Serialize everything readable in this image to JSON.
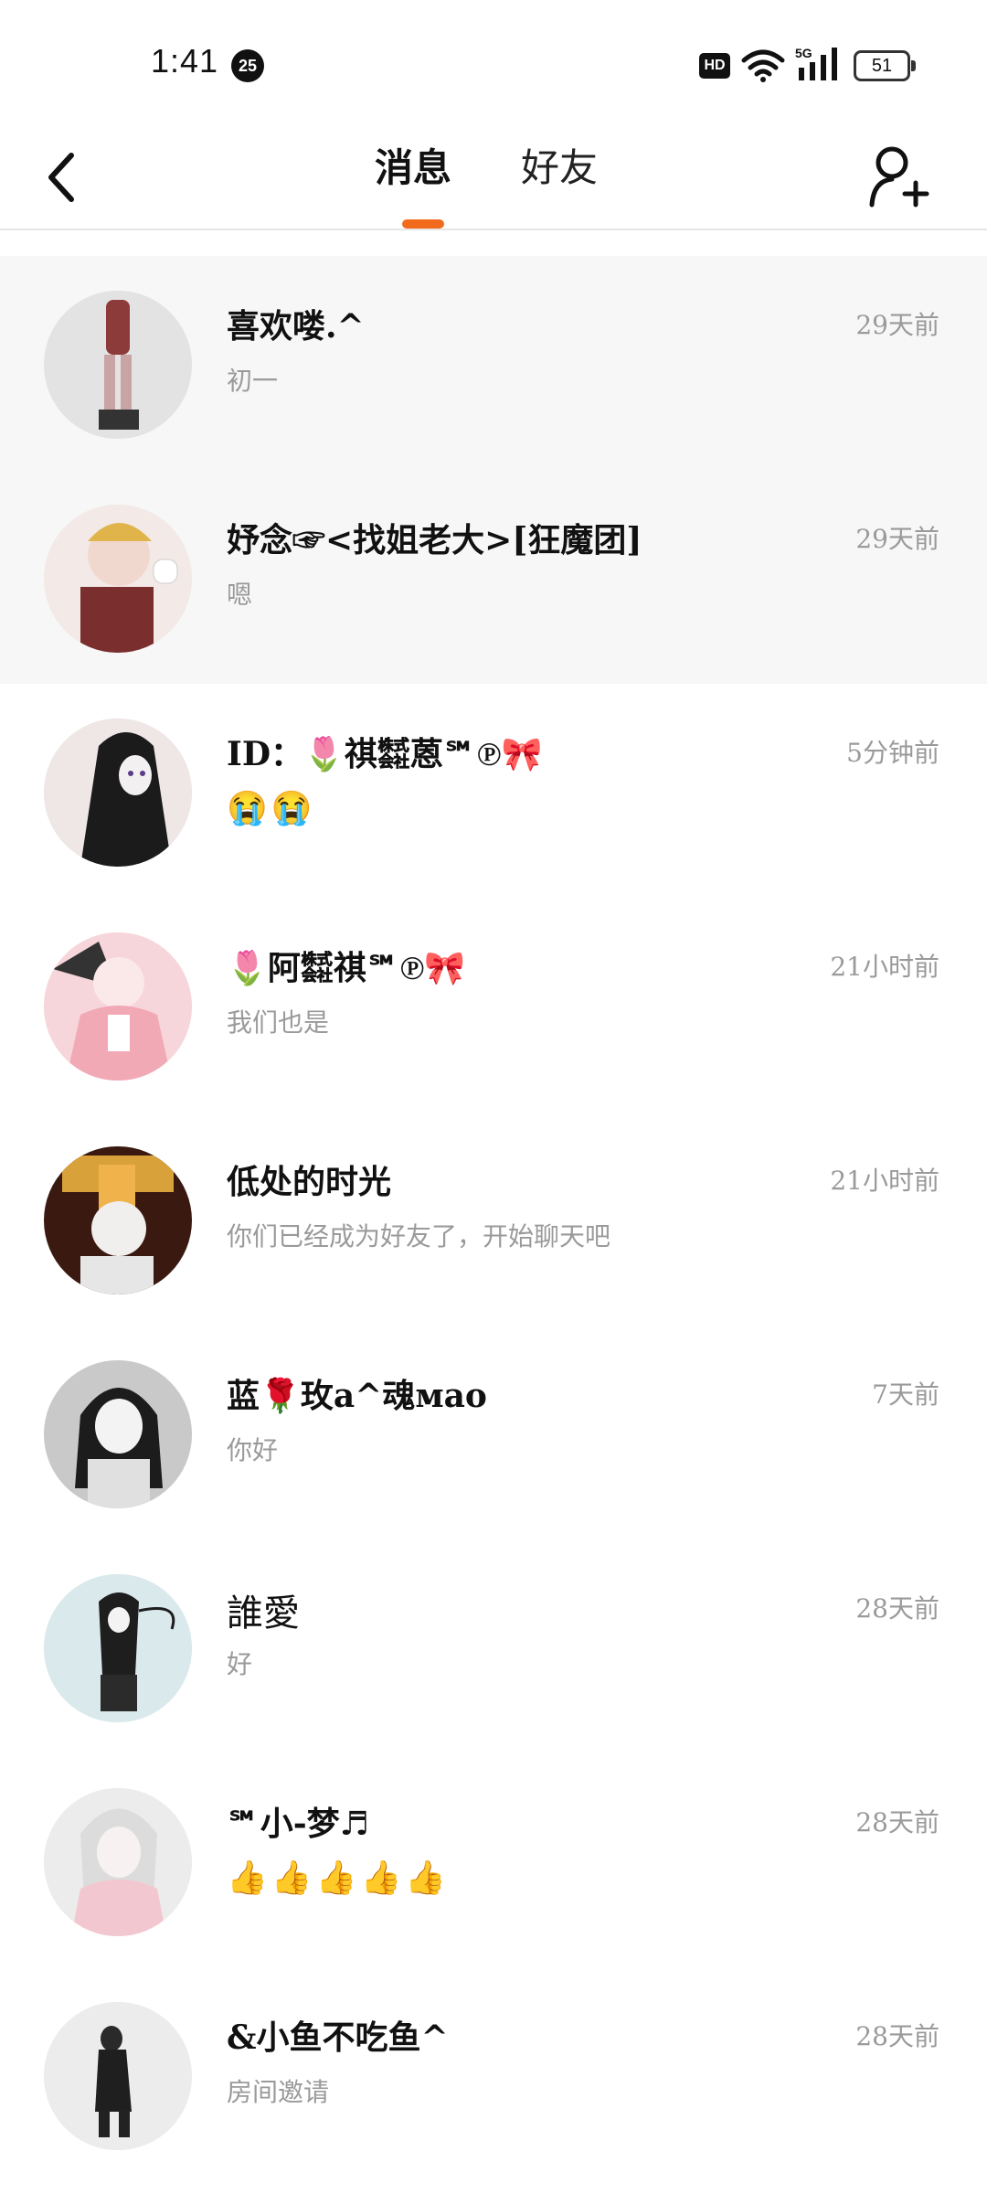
{
  "status_bar": {
    "time": "1:41",
    "notification_count": "25",
    "hd_label": "HD",
    "network_label": "5G",
    "battery_level": "51"
  },
  "header": {
    "tabs": [
      {
        "label": "消息",
        "active": true
      },
      {
        "label": "好友",
        "active": false
      }
    ],
    "accent_color": "#f26b1d"
  },
  "conversations": [
    {
      "name": "喜欢喽.^",
      "preview": "初一",
      "time": "29天前",
      "pinned": true,
      "avatar_bg": "#d9d9d9"
    },
    {
      "name": "妤念☞<找姐老大>[狂魔团]",
      "preview": "嗯",
      "time": "29天前",
      "pinned": true,
      "avatar_bg": "#f1e3e0"
    },
    {
      "name": "ID：🌷祺㍿蒽℠℗🎀",
      "preview": "😭😭",
      "time": "5分钟前",
      "pinned": false,
      "avatar_bg": "#2a2a2a"
    },
    {
      "name": "🌷阿㍿祺℠℗🎀",
      "preview": "我们也是",
      "time": "21小时前",
      "pinned": false,
      "avatar_bg": "#f4c9cf"
    },
    {
      "name": "低处的时光",
      "preview": "你们已经成为好友了，开始聊天吧",
      "time": "21小时前",
      "pinned": false,
      "avatar_bg": "#c98a3a"
    },
    {
      "name": "蓝🌹玫a^魂мao",
      "preview": "你好",
      "time": "7天前",
      "pinned": false,
      "avatar_bg": "#b9b9b9"
    },
    {
      "name": "誰愛",
      "preview": "好",
      "time": "28天前",
      "pinned": false,
      "avatar_bg": "#d7e7ea"
    },
    {
      "name": "℠小-梦♬",
      "preview": "👍👍👍👍👍",
      "time": "28天前",
      "pinned": false,
      "avatar_bg": "#e6e6e6"
    },
    {
      "name": "&小鱼不吃鱼^",
      "preview": "房间邀请",
      "time": "28天前",
      "pinned": false,
      "avatar_bg": "#ececec"
    }
  ]
}
